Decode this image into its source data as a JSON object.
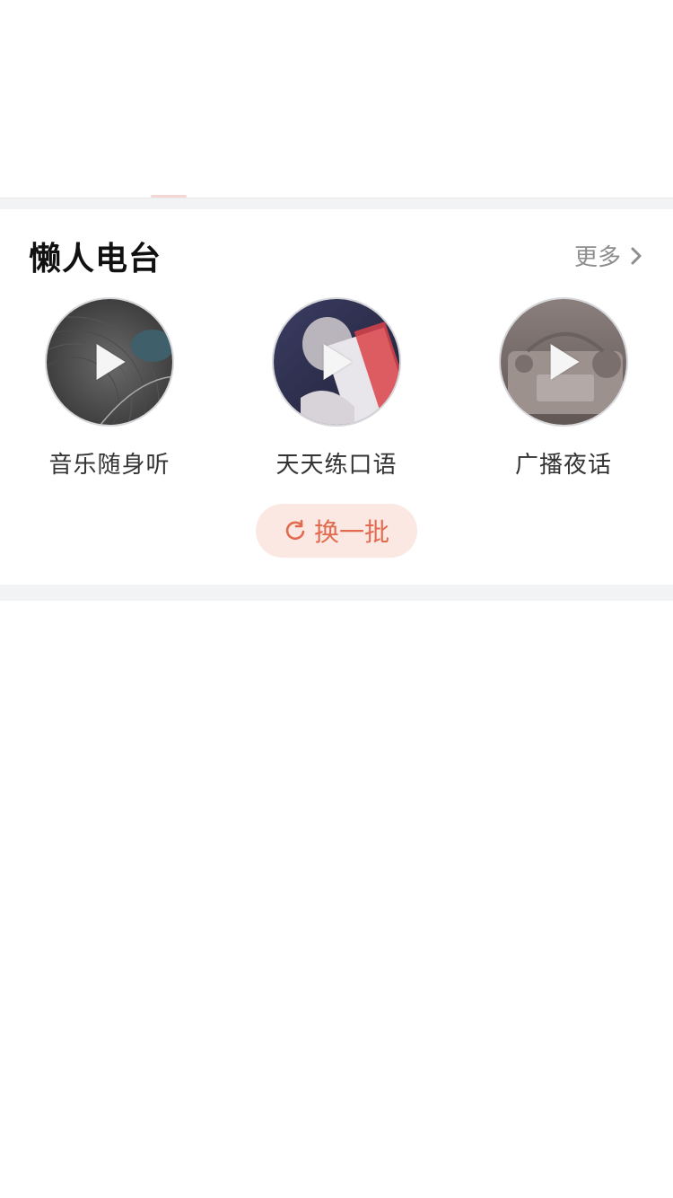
{
  "section": {
    "title": "懒人电台",
    "more_label": "更多"
  },
  "stations": [
    {
      "label": "音乐随身听",
      "icon": "vinyl-record-image"
    },
    {
      "label": "天天练口语",
      "icon": "reading-book-image"
    },
    {
      "label": "广播夜话",
      "icon": "radio-device-image"
    }
  ],
  "refresh": {
    "label": "换一批",
    "icon": "refresh-icon"
  },
  "colors": {
    "accent": "#e26a4f",
    "accent_bg": "#fbe8e3",
    "divider": "#f2f3f5",
    "title": "#111111",
    "muted": "#8e8e8e"
  }
}
